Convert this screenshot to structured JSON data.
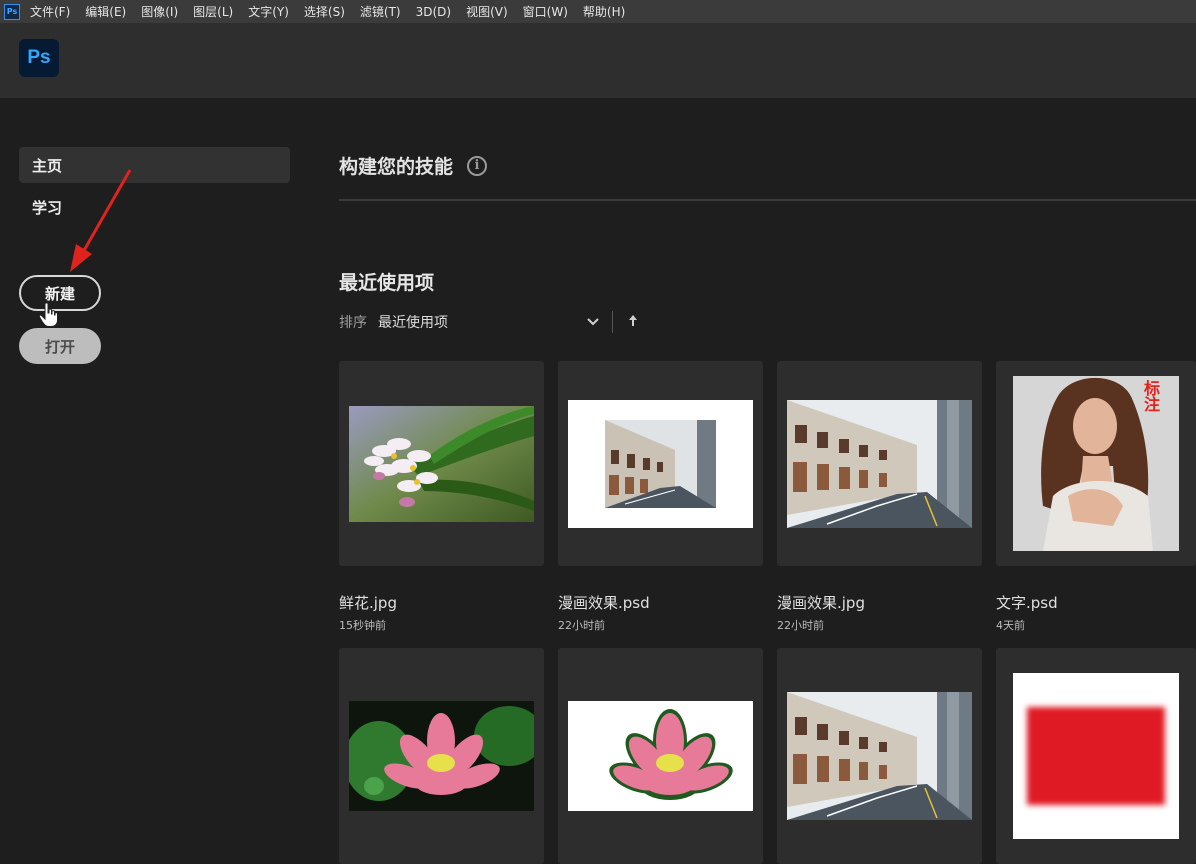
{
  "menubar": {
    "app_icon": "Ps",
    "items": [
      "文件(F)",
      "编辑(E)",
      "图像(I)",
      "图层(L)",
      "文字(Y)",
      "选择(S)",
      "滤镜(T)",
      "3D(D)",
      "视图(V)",
      "窗口(W)",
      "帮助(H)"
    ]
  },
  "header": {
    "logo": "Ps"
  },
  "sidebar": {
    "nav": [
      {
        "label": "主页",
        "active": true
      },
      {
        "label": "学习",
        "active": false
      }
    ],
    "new_button": "新建",
    "open_button": "打开"
  },
  "main": {
    "skills_title": "构建您的技能",
    "skills_info_icon": "info-icon",
    "recent_title": "最近使用项",
    "sort_label": "排序",
    "sort_value": "最近使用项",
    "sort_dropdown_icon": "chevron-down-icon",
    "sort_direction_icon": "arrow-up-icon",
    "files": [
      {
        "name": "鲜花.jpg",
        "time": "15秒钟前",
        "thumb": "flower-thumbnail"
      },
      {
        "name": "漫画效果.psd",
        "time": "22小时前",
        "thumb": "street-on-white-thumbnail"
      },
      {
        "name": "漫画效果.jpg",
        "time": "22小时前",
        "thumb": "street-thumbnail"
      },
      {
        "name": "文字.psd",
        "time": "4天前",
        "thumb": "portrait-thumbnail",
        "overlay_text": "标注"
      },
      {
        "name": "",
        "time": "",
        "thumb": "lotus-thumbnail"
      },
      {
        "name": "",
        "time": "",
        "thumb": "lotus-cutout-thumbnail"
      },
      {
        "name": "",
        "time": "",
        "thumb": "street-thumbnail"
      },
      {
        "name": "",
        "time": "",
        "thumb": "red-block-thumbnail"
      }
    ]
  },
  "colors": {
    "accent_blue": "#31a8ff",
    "background": "#1e1e1e",
    "annotation_red": "#e0231c"
  }
}
